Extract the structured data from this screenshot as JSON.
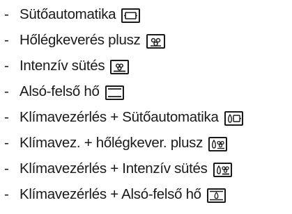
{
  "items": [
    {
      "dash": "-",
      "label": "Sütőautomatika",
      "icon": "bake-automatic-icon"
    },
    {
      "dash": "-",
      "label": "Hőlégkeverés plusz",
      "icon": "hot-air-plus-icon"
    },
    {
      "dash": "-",
      "label": "Intenzív sütés",
      "icon": "intensive-bake-icon"
    },
    {
      "dash": "-",
      "label": "Alsó-felső hő",
      "icon": "top-bottom-heat-icon"
    },
    {
      "dash": "-",
      "label": "Klímavezérlés + Sütőautomatika",
      "icon": "climate-bake-automatic-icon"
    },
    {
      "dash": "-",
      "label": "Klímavez. + hőlégkever. plusz",
      "icon": "climate-hot-air-plus-icon"
    },
    {
      "dash": "-",
      "label": "Klímavezérlés + Intenzív sütés",
      "icon": "climate-intensive-bake-icon"
    },
    {
      "dash": "-",
      "label": "Klímavezérlés + Alsó-felső hő",
      "icon": "climate-top-bottom-heat-icon"
    }
  ]
}
